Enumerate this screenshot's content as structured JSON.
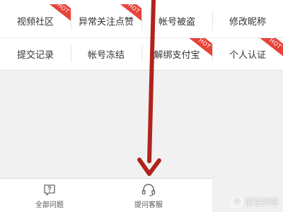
{
  "grid": {
    "rows": [
      [
        {
          "label": "视频社区",
          "hot": true
        },
        {
          "label": "异常关注点赞",
          "hot": true
        },
        {
          "label": "帐号被盗",
          "hot": false
        },
        {
          "label": "修改昵称",
          "hot": false
        }
      ],
      [
        {
          "label": "提交记录",
          "hot": false
        },
        {
          "label": "帐号冻结",
          "hot": false
        },
        {
          "label": "解绑支付宝",
          "hot": true
        },
        {
          "label": "个人认证",
          "hot": true
        }
      ]
    ],
    "hot_label": "HOT"
  },
  "bottom_bar": {
    "all_questions": "全部问题",
    "ask_service": "提问客服"
  },
  "watermark": {
    "text": "悟空问答",
    "logo_glyph": "✿"
  },
  "colors": {
    "arrow": "#b1231d",
    "hot_badge": "#e8433a",
    "background": "#f1f1f1"
  }
}
